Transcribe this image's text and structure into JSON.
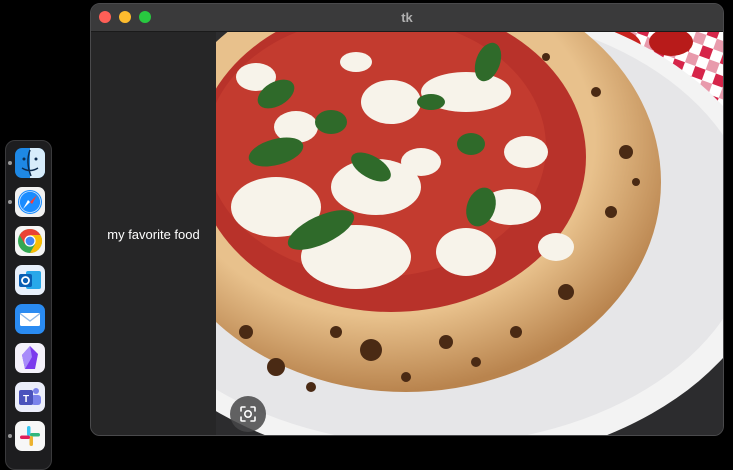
{
  "window": {
    "title": "tk",
    "caption": "my favorite food"
  },
  "dock": {
    "apps": [
      {
        "name": "Finder",
        "icon": "finder-icon",
        "running": true
      },
      {
        "name": "Safari",
        "icon": "safari-icon",
        "running": true
      },
      {
        "name": "Google Chrome",
        "icon": "chrome-icon",
        "running": false
      },
      {
        "name": "Microsoft Outlook",
        "icon": "outlook-icon",
        "running": false
      },
      {
        "name": "Mail",
        "icon": "mail-icon",
        "running": false
      },
      {
        "name": "Obsidian",
        "icon": "obsidian-icon",
        "running": false
      },
      {
        "name": "Microsoft Teams",
        "icon": "teams-icon",
        "running": false
      },
      {
        "name": "Slack",
        "icon": "slack-icon",
        "running": true
      }
    ]
  },
  "colors": {
    "close": "#ff5f57",
    "minimize": "#febc2e",
    "zoom": "#28c840"
  }
}
